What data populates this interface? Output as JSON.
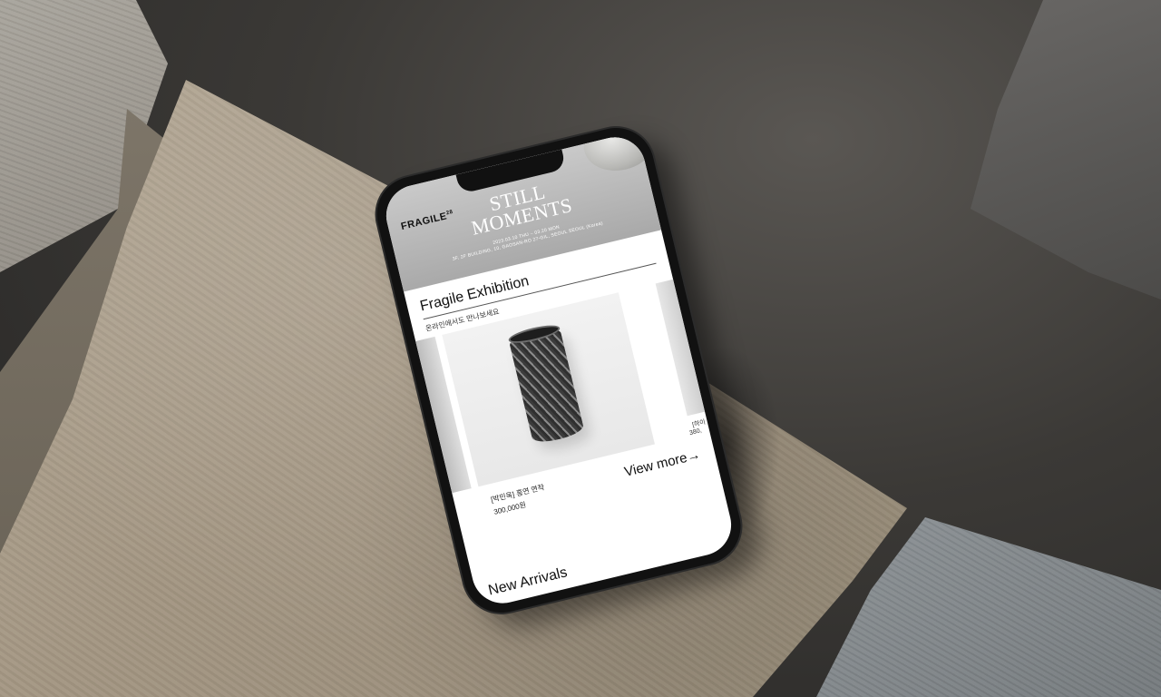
{
  "app": {
    "brand": "FRAGILE",
    "brand_mark": "28"
  },
  "hero": {
    "title_line1": "STILL",
    "title_line2": "MOMENTS",
    "subtitle_line1": "2023.03.10 THU – 03.20 MON",
    "subtitle_line2": "3F, 2F BUILDING, 10, GAOSAN-RO 27-GIL, SEOUL SEOUL (Korea)"
  },
  "exhibition": {
    "title": "Fragile Exhibition",
    "subtitle": "온라인에서도 만나보세요",
    "products": [
      {
        "name": "[박민욱] 흥연 연작",
        "price": "300,000원"
      },
      {
        "name": "[하이",
        "price": "380,"
      }
    ],
    "view_more_label": "View more→"
  },
  "next_section": {
    "title": "New Arrivals"
  },
  "colors": {
    "stone": "#a39682",
    "phone_frame": "#111111",
    "screen_bg": "#ffffff"
  }
}
